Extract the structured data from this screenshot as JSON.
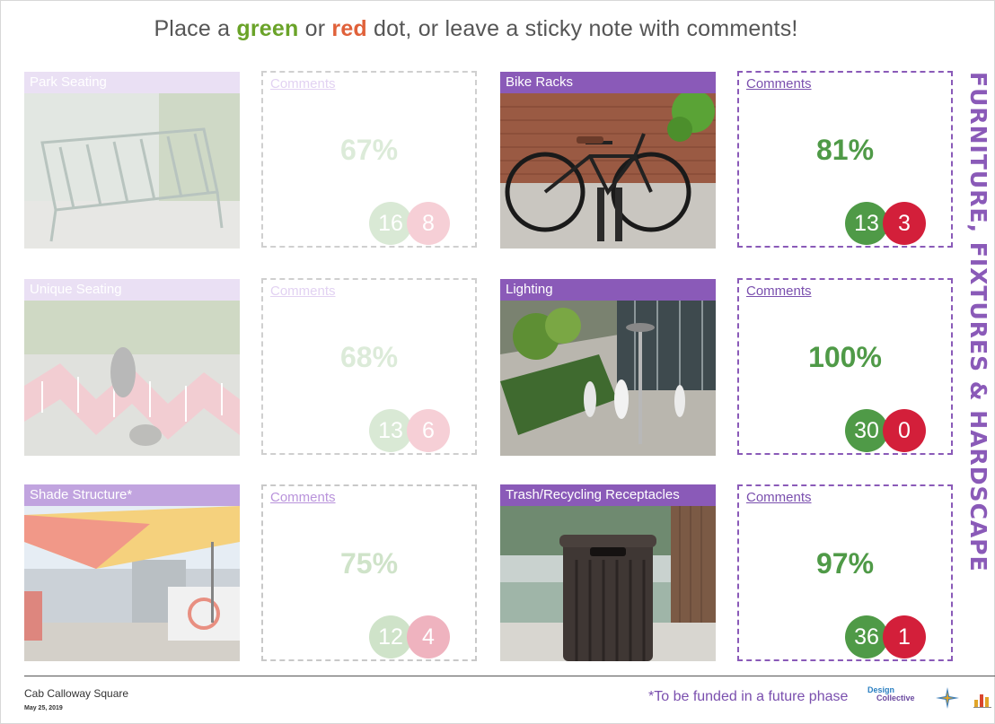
{
  "headline": {
    "prefix": "Place a ",
    "green_word": "green",
    "middle": " or ",
    "red_word": "red",
    "suffix": " dot, or leave a sticky note with comments!"
  },
  "side_title": "FURNITURE, FIXTURES & HARDSCAPE",
  "items": [
    {
      "label": "Park Seating",
      "comments_label": "Comments",
      "percent": "67%",
      "green": "16",
      "red": "8"
    },
    {
      "label": "Bike Racks",
      "comments_label": "Comments",
      "percent": "81%",
      "green": "13",
      "red": "3"
    },
    {
      "label": "Unique Seating",
      "comments_label": "Comments",
      "percent": "68%",
      "green": "13",
      "red": "6"
    },
    {
      "label": "Lighting",
      "comments_label": "Comments",
      "percent": "100%",
      "green": "30",
      "red": "0"
    },
    {
      "label": "Shade Structure*",
      "comments_label": "Comments",
      "percent": "75%",
      "green": "12",
      "red": "4"
    },
    {
      "label": "Trash/Recycling Receptacles",
      "comments_label": "Comments",
      "percent": "97%",
      "green": "36",
      "red": "1"
    }
  ],
  "footer": {
    "venue": "Cab Calloway Square",
    "date": "May 25, 2019",
    "funding_note": "*To be funded in a future phase",
    "logo_text_top": "Design",
    "logo_text_bottom": "Collective"
  },
  "colors": {
    "accent_purple": "#8a5ab8",
    "green_dot": "#4f9a47",
    "red_dot": "#d31f3a"
  }
}
